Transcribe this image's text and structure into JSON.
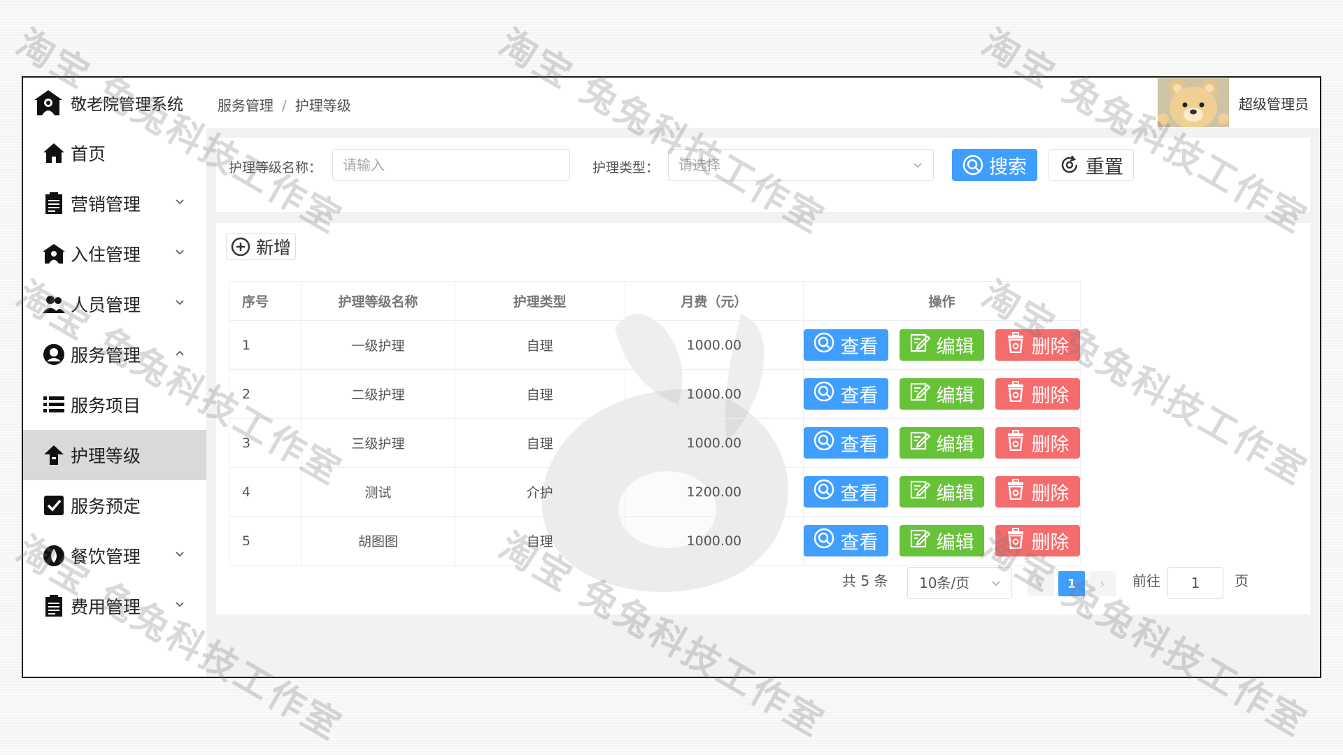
{
  "app": {
    "title": "敬老院管理系统"
  },
  "sidebar": {
    "items": [
      {
        "label": "首页",
        "icon": "home-icon"
      },
      {
        "label": "营销管理",
        "icon": "clipboard-icon",
        "expandable": true
      },
      {
        "label": "入住管理",
        "icon": "building-icon",
        "expandable": true
      },
      {
        "label": "人员管理",
        "icon": "users-icon",
        "expandable": true
      },
      {
        "label": "服务管理",
        "icon": "service-icon",
        "expandable": true,
        "expanded": true
      },
      {
        "label": "服务项目",
        "icon": "list-icon"
      },
      {
        "label": "护理等级",
        "icon": "level-icon",
        "active": true
      },
      {
        "label": "服务预定",
        "icon": "check-icon"
      },
      {
        "label": "餐饮管理",
        "icon": "drop-icon",
        "expandable": true
      },
      {
        "label": "费用管理",
        "icon": "clipboard-icon",
        "expandable": true
      }
    ]
  },
  "header": {
    "breadcrumb": [
      "服务管理",
      "护理等级"
    ],
    "breadcrumb_sep": "/",
    "user_name": "超级管理员"
  },
  "search": {
    "name_label": "护理等级名称：",
    "name_placeholder": "请输入",
    "type_label": "护理类型：",
    "type_placeholder": "请选择",
    "search_button": "搜索",
    "reset_button": "重置"
  },
  "toolbar": {
    "add_button": "新增"
  },
  "table": {
    "columns": [
      "序号",
      "护理等级名称",
      "护理类型",
      "月费（元）",
      "操作"
    ],
    "rows": [
      {
        "idx": "1",
        "name": "一级护理",
        "type": "自理",
        "fee": "1000.00"
      },
      {
        "idx": "2",
        "name": "二级护理",
        "type": "自理",
        "fee": "1000.00"
      },
      {
        "idx": "3",
        "name": "三级护理",
        "type": "自理",
        "fee": "1000.00"
      },
      {
        "idx": "4",
        "name": "测试",
        "type": "介护",
        "fee": "1200.00"
      },
      {
        "idx": "5",
        "name": "胡图图",
        "type": "自理",
        "fee": "1000.00"
      }
    ],
    "actions": {
      "view": "查看",
      "edit": "编辑",
      "delete": "删除"
    }
  },
  "pagination": {
    "total_text": "共 5 条",
    "page_size": "10条/页",
    "prev": "‹",
    "current": "1",
    "next": "›",
    "goto_label": "前往",
    "goto_value": "1",
    "page_suffix": "页"
  },
  "watermark": {
    "text": "淘宝 兔兔科技工作室"
  },
  "colors": {
    "primary": "#409eff",
    "success": "#67c23a",
    "danger": "#f56c6c",
    "active_menu": "#d9d9d9"
  }
}
